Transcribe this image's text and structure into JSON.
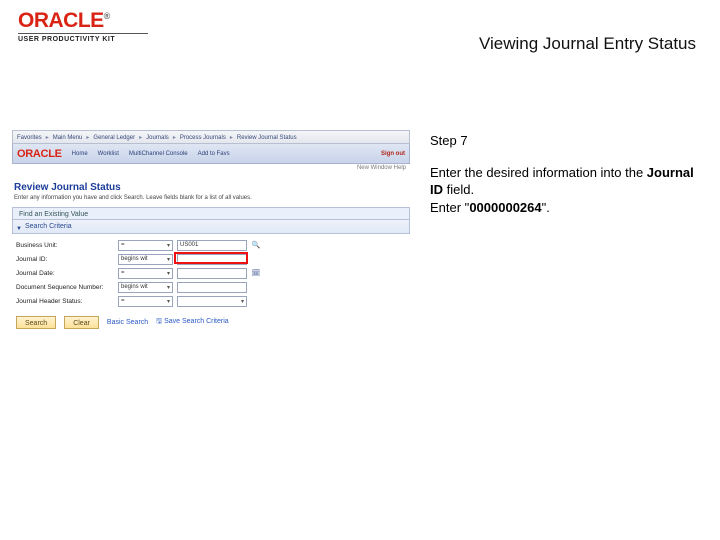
{
  "header": {
    "brand": "ORACLE",
    "upk": "USER PRODUCTIVITY KIT",
    "page_title": "Viewing Journal Entry Status"
  },
  "instruction": {
    "step_label": "Step 7",
    "line1_pre": "Enter the desired information into the ",
    "line1_b": "Journal ID",
    "line1_post": " field.",
    "line2_pre": "Enter \"",
    "line2_b": "0000000264",
    "line2_post": "\"."
  },
  "shot": {
    "crumbs": [
      "Favorites",
      "Main Menu",
      "General Ledger",
      "Journals",
      "Process Journals",
      "Review Journal Status"
    ],
    "mini_brand": "ORACLE",
    "nav": [
      "Home",
      "Worklist",
      "MultiChannel Console",
      "Add to Favs"
    ],
    "signout": "Sign out",
    "util_right": "New Window   Help",
    "section_title": "Review Journal Status",
    "section_desc": "Enter any information you have and click Search. Leave fields blank for a list of all values.",
    "find_bar": "Find an Existing Value",
    "criteria_head": "Search Criteria",
    "rows": {
      "bu": {
        "label": "Business Unit:",
        "op": "=",
        "val": "US001"
      },
      "jid": {
        "label": "Journal ID:",
        "op": "begins wit",
        "val": ""
      },
      "jdt": {
        "label": "Journal Date:",
        "op": "=",
        "val": ""
      },
      "dsr": {
        "label": "Document Sequence Number:",
        "op": "begins wit",
        "val": ""
      },
      "hdr": {
        "label": "Journal Header Status:",
        "op": "=",
        "val": ""
      }
    },
    "buttons": {
      "search": "Search",
      "clear": "Clear",
      "basic": "Basic Search",
      "save": "Save Search Criteria"
    }
  }
}
